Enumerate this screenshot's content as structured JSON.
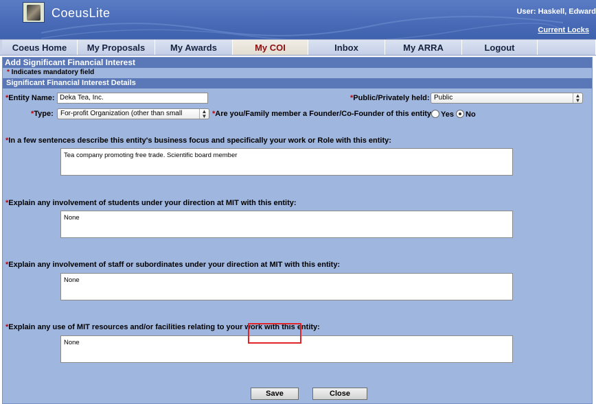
{
  "header": {
    "app_title": "CoeusLite",
    "user_label": "User:  Haskell, Edward",
    "current_locks": "Current Locks"
  },
  "nav": {
    "tabs": [
      {
        "label": "Coeus Home",
        "active": false
      },
      {
        "label": "My Proposals",
        "active": false
      },
      {
        "label": "My Awards",
        "active": false
      },
      {
        "label": "My COI",
        "active": true
      },
      {
        "label": "Inbox",
        "active": false
      },
      {
        "label": "My ARRA",
        "active": false
      },
      {
        "label": "Logout",
        "active": false
      }
    ]
  },
  "page": {
    "title": "Add Significant Financial Interest",
    "mandatory_star": "*",
    "mandatory_note": " Indicates mandatory field",
    "section_title": "Significant Financial Interest Details"
  },
  "form": {
    "entity_name_label": "Entity Name:",
    "entity_name_value": "Deka Tea, Inc.",
    "public_private_label": "Public/Privately held:",
    "public_private_value": "Public",
    "type_label": "Type:",
    "type_value": "For-profit Organization (other than small",
    "founder_label": "Are you/Family member a Founder/Co-Founder of this entity?",
    "founder_yes": "Yes",
    "founder_no": "No",
    "founder_selected": "No",
    "q1_label": "In a few sentences describe this entity's business focus and specifically your work or Role with this entity:",
    "q1_value": "Tea company promoting free trade.  Scientific board member",
    "q2_label": "Explain any involvement of students under your direction at MIT with this entity:",
    "q2_value": "None",
    "q3_label": "Explain any involvement of staff or subordinates under your direction at MIT with this entity:",
    "q3_value": "None",
    "q4_label": "Explain any use of MIT resources and/or facilities relating to your work with this entity:",
    "q4_value": "None",
    "required_star": "*"
  },
  "actions": {
    "save_label": "Save",
    "close_label": "Close"
  },
  "colors": {
    "banner": "#4a6cb8",
    "panel": "#9fb6df",
    "section_header": "#5a78b8",
    "active_tab_text": "#8b1010",
    "required": "#c00000",
    "save_highlight": "#e0242a"
  },
  "icons": {
    "logo": "coeus-logo-icon",
    "select_arrows": "updown-arrows-icon"
  }
}
